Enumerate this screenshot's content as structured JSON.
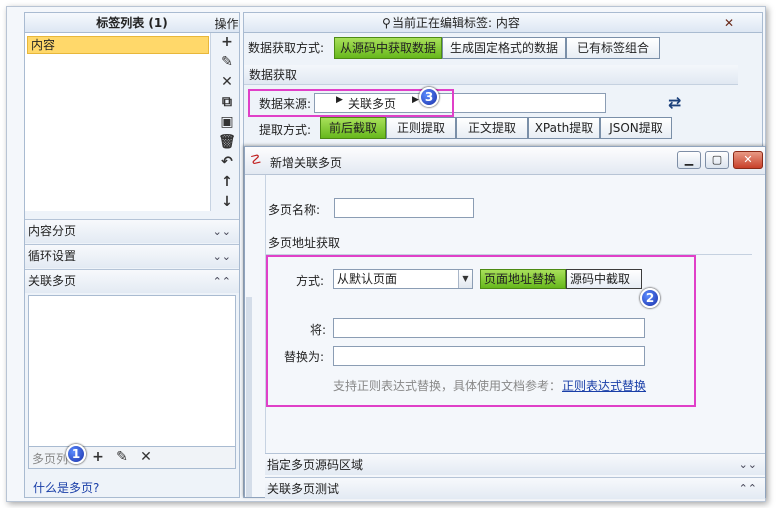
{
  "left": {
    "tag_list_title": "标签列表 (1)",
    "tags": [
      "内容"
    ],
    "ops_title": "操作",
    "sections": [
      "内容分页",
      "循环设置",
      "关联多页"
    ],
    "multi_footer_label": "多页列",
    "help_link": "什么是多页?"
  },
  "main": {
    "editing_text": "当前正在编辑标签: 内容",
    "mode_label": "数据获取方式:",
    "modes": [
      "从源码中获取数据",
      "生成固定格式的数据",
      "已有标签组合"
    ],
    "active_mode": "从源码中获取数据",
    "section_title": "数据获取",
    "source_label": "数据来源:",
    "source_value": "关联多页",
    "extract_label": "提取方式:",
    "extract_modes": [
      "前后截取",
      "正则提取",
      "正文提取",
      "XPath提取",
      "JSON提取"
    ],
    "active_extract": "前后截取"
  },
  "dialog": {
    "title": "新增关联多页",
    "name_label": "多页名称:",
    "name_value": "",
    "url_section": "多页地址获取",
    "method_label": "方式:",
    "method_value": "从默认页面",
    "method_buttons": [
      "页面地址替换",
      "源码中截取"
    ],
    "active_method": "页面地址替换",
    "replace_label": "将:",
    "replace_value": "",
    "with_label": "替换为:",
    "with_value": "",
    "hint": "支持正则表达式替换，具体使用文档参考：",
    "hint_link": "正则表达式替换",
    "sections": [
      "指定多页源码区域",
      "关联多页测试"
    ]
  },
  "badges": [
    "1",
    "2",
    "3"
  ],
  "colors": {
    "active_green": "#7fcb2e",
    "highlight_pink": "#e040c8",
    "badge_blue": "#1f3fb4"
  }
}
